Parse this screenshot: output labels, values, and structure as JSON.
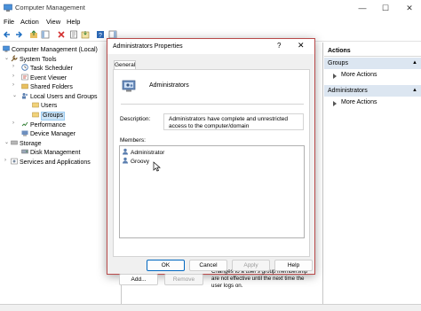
{
  "window": {
    "title": "Computer Management",
    "controls": {
      "minimize": "—",
      "maximize": "☐",
      "close": "✕"
    }
  },
  "menu": [
    "File",
    "Action",
    "View",
    "Help"
  ],
  "tree": {
    "root": "Computer Management (Local)",
    "system_tools": "System Tools",
    "task_scheduler": "Task Scheduler",
    "event_viewer": "Event Viewer",
    "shared_folders": "Shared Folders",
    "local_users": "Local Users and Groups",
    "users": "Users",
    "groups": "Groups",
    "performance": "Performance",
    "device_manager": "Device Manager",
    "storage": "Storage",
    "disk_management": "Disk Management",
    "services": "Services and Applications"
  },
  "actions_pane": {
    "header": "Actions",
    "section1": "Groups",
    "more1": "More Actions",
    "section2": "Administrators",
    "more2": "More Actions"
  },
  "dialog": {
    "title": "Administrators Properties",
    "help": "?",
    "close": "✕",
    "tab": "General",
    "group_name": "Administrators",
    "description_label": "Description:",
    "description": "Administrators have complete and unrestricted access to the computer/domain",
    "members_label": "Members:",
    "members": [
      "Administrator",
      "Groovy"
    ],
    "add": "Add...",
    "remove": "Remove",
    "note": "Changes to a user's group membership are not effective until the next time the user logs on.",
    "ok": "OK",
    "cancel": "Cancel",
    "apply": "Apply",
    "help_button": "Help"
  },
  "colors": {
    "dialog_border": "#b94a4a",
    "selection": "#cce4f7",
    "accent": "#0067c0"
  }
}
